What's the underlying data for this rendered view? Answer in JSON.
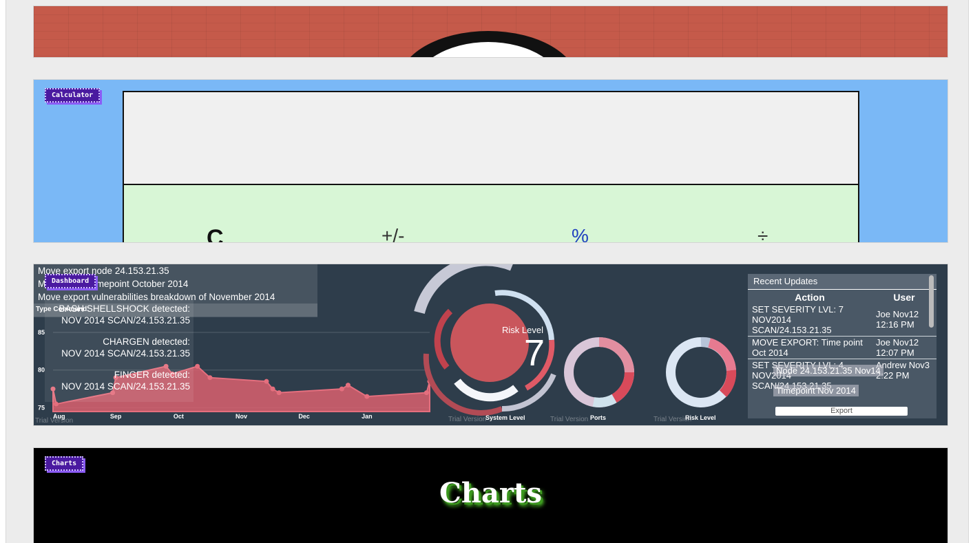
{
  "tags": {
    "calculator": "Calculator",
    "dashboard": "Dashboard",
    "charts": "Charts"
  },
  "calculator": {
    "keys": [
      "C",
      "+/-",
      "%",
      "÷"
    ]
  },
  "dashboard": {
    "command_log": [
      "Move export node 24.153.21.35",
      "Move export timepoint October 2014",
      "Move export vulnerabilities breakdown of November 2014"
    ],
    "command_label": "Type Command:",
    "alerts": [
      {
        "title": "BASH SHELLSHOCK detected:",
        "detail": "NOV 2014 SCAN/24.153.21.35"
      },
      {
        "title": "CHARGEN detected:",
        "detail": "NOV 2014 SCAN/24.153.21.35"
      },
      {
        "title": "FINGER detected:",
        "detail": "NOV 2014 SCAN/24.153.21.35"
      }
    ],
    "risk_label": "Risk Level",
    "risk_value": "7",
    "ring_labels": {
      "system": "System Level",
      "ports": "Ports",
      "risk": "Risk Level"
    },
    "trial": "Trial Version",
    "updates": {
      "title": "Recent Updates",
      "col_action": "Action",
      "col_user": "User",
      "rows": [
        {
          "action": "SET SEVERITY LVL: 7 NOV2014 SCAN/24.153.21.35",
          "user": "Joe Nov12 12:16 PM"
        },
        {
          "action": "MOVE EXPORT: Time point Oct 2014",
          "user": "Joe Nov12 12:07 PM"
        },
        {
          "action": "SET SEVERITY LVL: 4 NOV2014 SCAN/24.153.21.35",
          "user": "Andrew Nov3 2:22 PM"
        }
      ],
      "export": "Export"
    },
    "tooltips": {
      "node": "Node 24.153.21.35 Nov14",
      "timepoint": "Timepoint Nov 2014"
    },
    "colors": {
      "bg": "#2e3d4b",
      "area": "#d9606e",
      "risk": "#c9565c"
    }
  },
  "chart_data": {
    "type": "area",
    "categories": [
      "Aug",
      "Sep",
      "Oct",
      "Nov",
      "Dec",
      "Jan"
    ],
    "x": [
      0.0,
      0.05,
      0.95,
      1.0,
      1.8,
      1.9,
      2.3,
      2.5,
      3.4,
      3.5,
      3.6,
      4.6,
      4.7,
      5.0,
      5.95,
      6.0
    ],
    "values": [
      77.5,
      75.5,
      77.0,
      79.0,
      80.5,
      79.5,
      80.5,
      79.0,
      78.5,
      77.5,
      77.0,
      77.5,
      78.0,
      76.5,
      77.0,
      78.5
    ],
    "yticks": [
      75,
      80,
      85
    ],
    "ylim": [
      74.5,
      86
    ],
    "xlabel": "",
    "ylabel": ""
  },
  "charts_card": {
    "title": "Charts"
  }
}
